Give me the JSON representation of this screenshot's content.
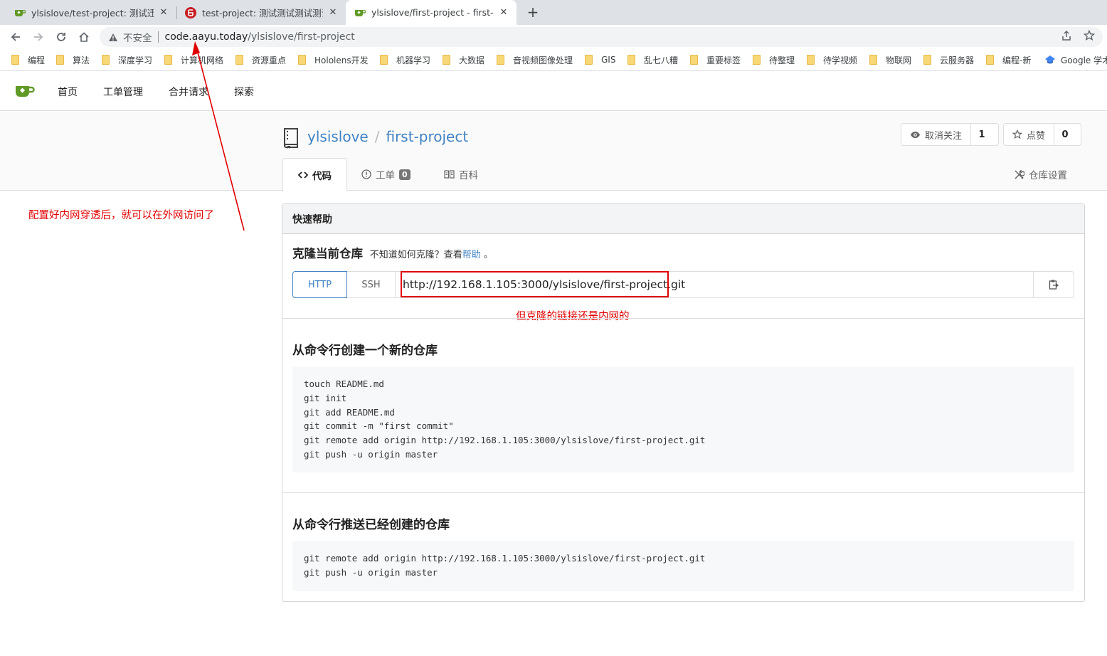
{
  "browser": {
    "tabs": [
      {
        "title": "ylsislove/test-project: 测试迁移",
        "icon": "gitea-tea-icon",
        "active": false
      },
      {
        "title": "test-project: 测试测试测试测试测",
        "icon": "gitee-icon",
        "active": false
      },
      {
        "title": "ylsislove/first-project - first-pr",
        "icon": "gitea-tea-icon",
        "active": true
      }
    ],
    "new_tab": "+",
    "close_glyph": "✕",
    "address": {
      "security_label": "不安全",
      "host": "code.aayu.today",
      "path": "/ylsislove/first-project"
    },
    "bookmarks": [
      "编程",
      "算法",
      "深度学习",
      "计算机网络",
      "资源重点",
      "Hololens开发",
      "机器学习",
      "大数据",
      "音视频图像处理",
      "GIS",
      "乱七八糟",
      "重要标签",
      "待整理",
      "待学视频",
      "物联网",
      "云服务器",
      "编程-新",
      "Google 学术"
    ]
  },
  "site_nav": {
    "items": [
      "首页",
      "工单管理",
      "合并请求",
      "探索"
    ]
  },
  "repo": {
    "owner": "ylsislove",
    "name": "first-project",
    "separator": "/",
    "watch": {
      "label": "取消关注",
      "count": "1"
    },
    "star": {
      "label": "点赞",
      "count": "0"
    },
    "tabs": {
      "code": "代码",
      "issues": "工单",
      "issues_count": "0",
      "wiki": "百科",
      "settings": "仓库设置"
    }
  },
  "quick_help": {
    "title": "快速帮助",
    "clone_heading": "克隆当前仓库",
    "clone_hint": "不知道如何克隆？查看",
    "clone_hint_link": "帮助",
    "clone_hint_end": "。",
    "protocols": [
      "HTTP",
      "SSH"
    ],
    "clone_url": "http://192.168.1.105:3000/ylsislove/first-project.git",
    "new_repo_heading": "从命令行创建一个新的仓库",
    "new_repo_commands": "touch README.md\ngit init\ngit add README.md\ngit commit -m \"first commit\"\ngit remote add origin http://192.168.1.105:3000/ylsislove/first-project.git\ngit push -u origin master",
    "push_existing_heading": "从命令行推送已经创建的仓库",
    "push_existing_commands": "git remote add origin http://192.168.1.105:3000/ylsislove/first-project.git\ngit push -u origin master"
  },
  "annotations": {
    "left_note": "配置好内网穿透后，就可以在外网访问了",
    "url_note": "但克隆的链接还是内网的",
    "color": "#e00000"
  },
  "colors": {
    "link": "#4183c4",
    "gitea_green": "#609926"
  }
}
